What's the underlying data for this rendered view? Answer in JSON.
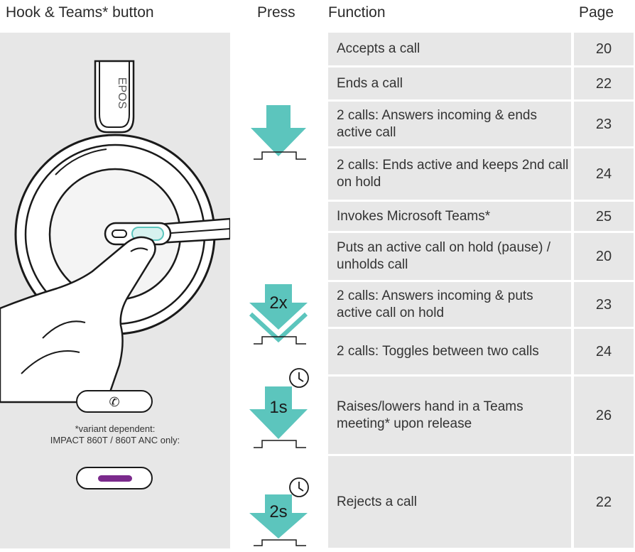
{
  "header": {
    "col1": "Hook & Teams* button",
    "col2": "Press",
    "col3": "Function",
    "col4": "Page"
  },
  "illustration": {
    "brand_text": "EPOS",
    "note_line1": "*variant dependent:",
    "note_line2": "IMPACT 860T / 860T ANC only:",
    "teams_bar_color": "#7b2a8c",
    "accent_color": "#5cc5bd"
  },
  "press_symbols": [
    {
      "label": "",
      "icon": "single-press-arrow-icon"
    },
    {
      "label": "2x",
      "icon": "double-press-arrow-icon"
    },
    {
      "label": "1s",
      "icon": "hold-1s-press-arrow-icon"
    },
    {
      "label": "2s",
      "icon": "hold-2s-press-arrow-icon"
    }
  ],
  "rows": [
    {
      "function": "Accepts a call",
      "page": "20"
    },
    {
      "function": "Ends a call",
      "page": "22"
    },
    {
      "function": "2 calls: Answers incoming & ends active call",
      "page": "23"
    },
    {
      "function": "2 calls: Ends active and keeps 2nd call on hold",
      "page": "24"
    },
    {
      "function": "Invokes Microsoft Teams*",
      "page": "25"
    },
    {
      "function": "Puts an active call on hold (pause) / unholds call",
      "page": "20"
    },
    {
      "function": "2 calls: Answers incoming & puts active call on hold",
      "page": "23"
    },
    {
      "function": "2 calls: Toggles between two calls",
      "page": "24"
    },
    {
      "function": "Raises/lowers hand in a Teams meeting* upon release",
      "page": "26"
    },
    {
      "function": "Rejects a call",
      "page": "22"
    }
  ]
}
